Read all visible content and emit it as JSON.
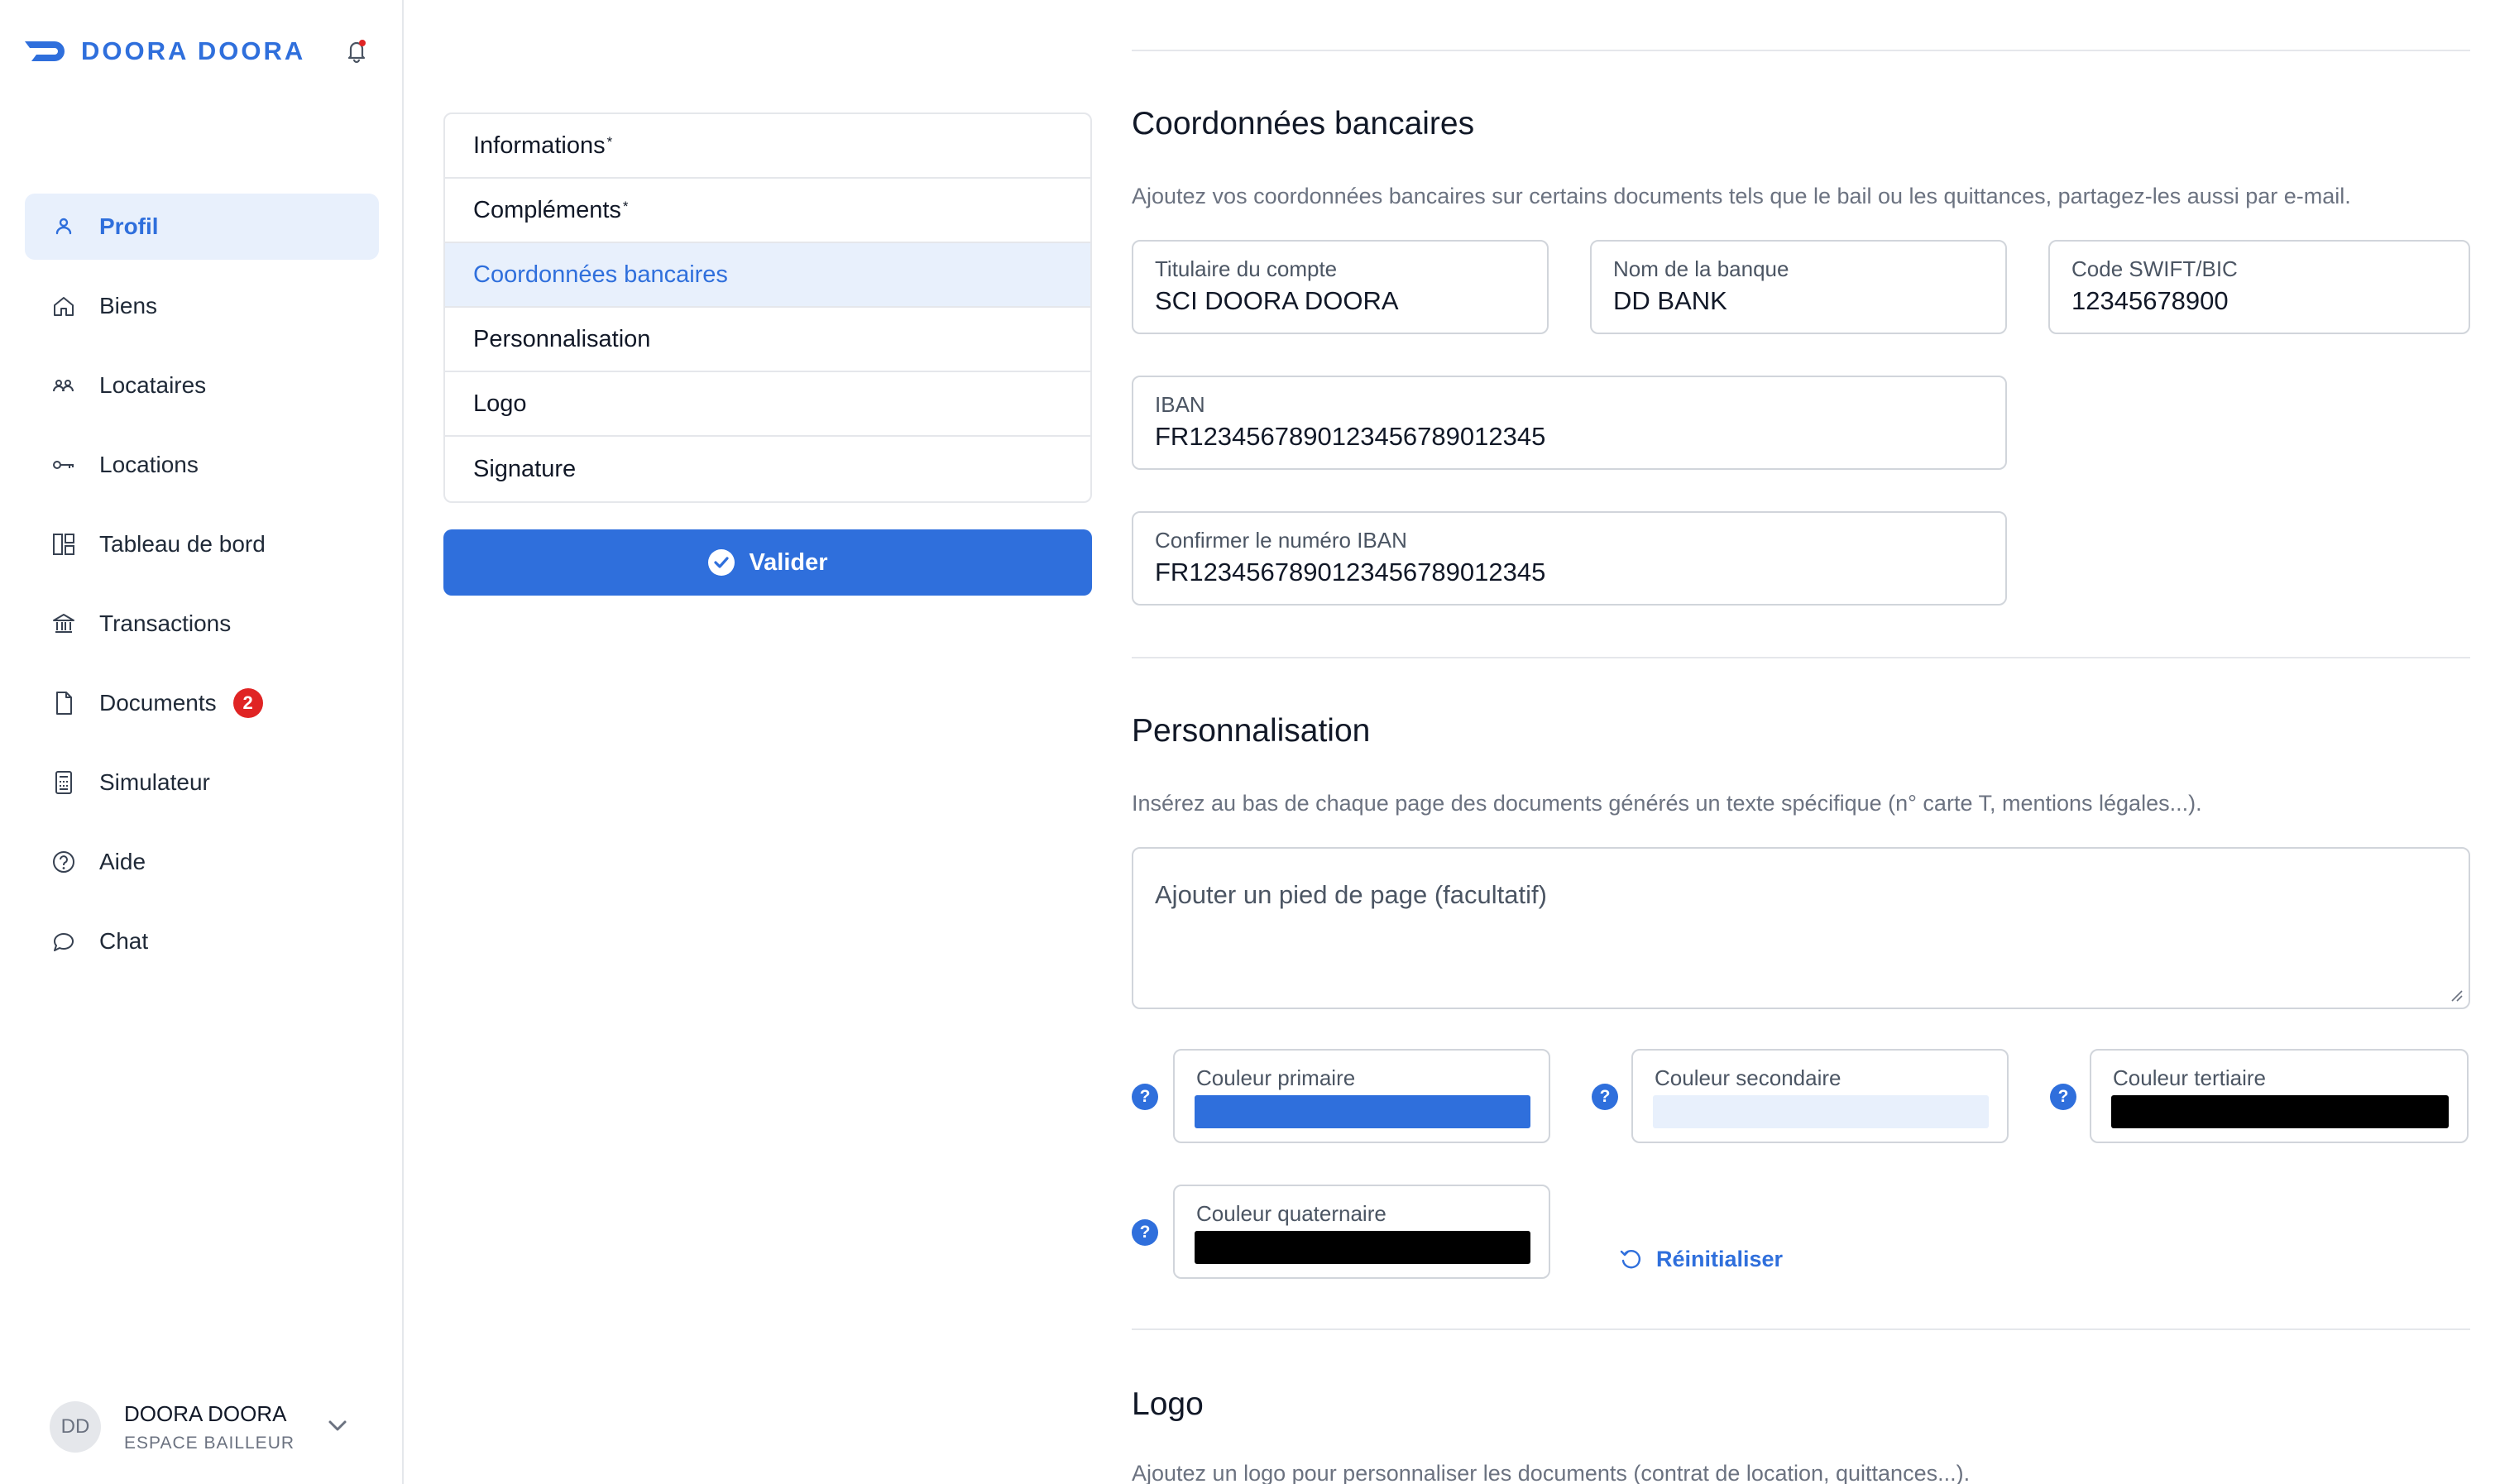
{
  "brand": {
    "name": "DOORA DOORA"
  },
  "icons": {
    "bell": "bell-icon",
    "valider": "check-circle-icon",
    "help": "question-icon",
    "reset": "rotate-ccw-icon",
    "user_menu": "chevron-down-icon"
  },
  "colors": {
    "accent": "#2f6fdc",
    "accent_light": "#e8f0fc",
    "badge": "#e02424",
    "primary_color": "#2f6fdc",
    "secondary_color": "#e8f0fc",
    "tertiary_color": "#000000",
    "quaternary_color": "#000000"
  },
  "sidebar": {
    "items": [
      {
        "label": "Profil",
        "icon": "user-icon"
      },
      {
        "label": "Biens",
        "icon": "home-icon"
      },
      {
        "label": "Locataires",
        "icon": "users-icon"
      },
      {
        "label": "Locations",
        "icon": "key-icon"
      },
      {
        "label": "Tableau de bord",
        "icon": "dashboard-icon"
      },
      {
        "label": "Transactions",
        "icon": "bank-icon"
      },
      {
        "label": "Documents",
        "icon": "document-icon",
        "badge": "2"
      },
      {
        "label": "Simulateur",
        "icon": "calculator-icon"
      },
      {
        "label": "Aide",
        "icon": "help-circle-icon"
      },
      {
        "label": "Chat",
        "icon": "chat-icon"
      }
    ],
    "user": {
      "initials": "DD",
      "name": "DOORA DOORA",
      "role": "ESPACE BAILLEUR"
    }
  },
  "menu": {
    "items": [
      {
        "label": "Informations",
        "required": "*"
      },
      {
        "label": "Compléments",
        "required": "*"
      },
      {
        "label": "Coordonnées bancaires"
      },
      {
        "label": "Personnalisation"
      },
      {
        "label": "Logo"
      },
      {
        "label": "Signature"
      }
    ],
    "submit_label": "Valider"
  },
  "bank": {
    "title": "Coordonnées bancaires",
    "description": "Ajoutez vos coordonnées bancaires sur certains documents tels que le bail ou les quittances, partagez-les aussi par e-mail.",
    "holder_label": "Titulaire du compte",
    "holder_value": "SCI DOORA DOORA",
    "bank_label": "Nom de la banque",
    "bank_value": "DD BANK",
    "swift_label": "Code SWIFT/BIC",
    "swift_value": "12345678900",
    "iban_label": "IBAN",
    "iban_value": "FR1234567890123456789012345",
    "iban_confirm_label": "Confirmer le numéro IBAN",
    "iban_confirm_value": "FR1234567890123456789012345"
  },
  "perso": {
    "title": "Personnalisation",
    "description": "Insérez au bas de chaque page des documents générés un texte spécifique (n° carte T, mentions légales...).",
    "footer_placeholder": "Ajouter un pied de page (facultatif)",
    "primary_label": "Couleur primaire",
    "secondary_label": "Couleur secondaire",
    "tertiary_label": "Couleur tertiaire",
    "quaternary_label": "Couleur quaternaire",
    "help_glyph": "?",
    "reset_label": "Réinitialiser"
  },
  "logo": {
    "title": "Logo",
    "description": "Ajoutez un logo pour personnaliser les documents (contrat de location, quittances...)."
  }
}
